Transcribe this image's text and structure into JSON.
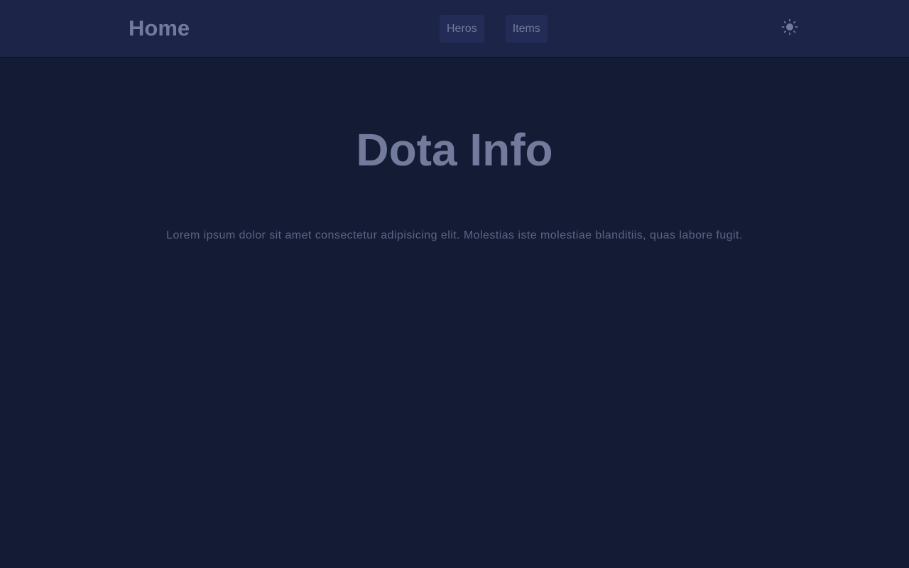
{
  "navbar": {
    "brand": "Home",
    "links": [
      {
        "label": "Heros"
      },
      {
        "label": "Items"
      }
    ],
    "theme_toggle_icon": "sun-icon"
  },
  "main": {
    "title": "Dota Info",
    "intro": "Lorem ipsum dolor sit amet consectetur adipisicing elit. Molestias iste molestiae blanditiis, quas labore fugit."
  },
  "colors": {
    "background": "#141b35",
    "navbar": "#1c2548",
    "nav_button": "#222c56",
    "text": "#737b9c",
    "muted_text": "#5d6585"
  }
}
